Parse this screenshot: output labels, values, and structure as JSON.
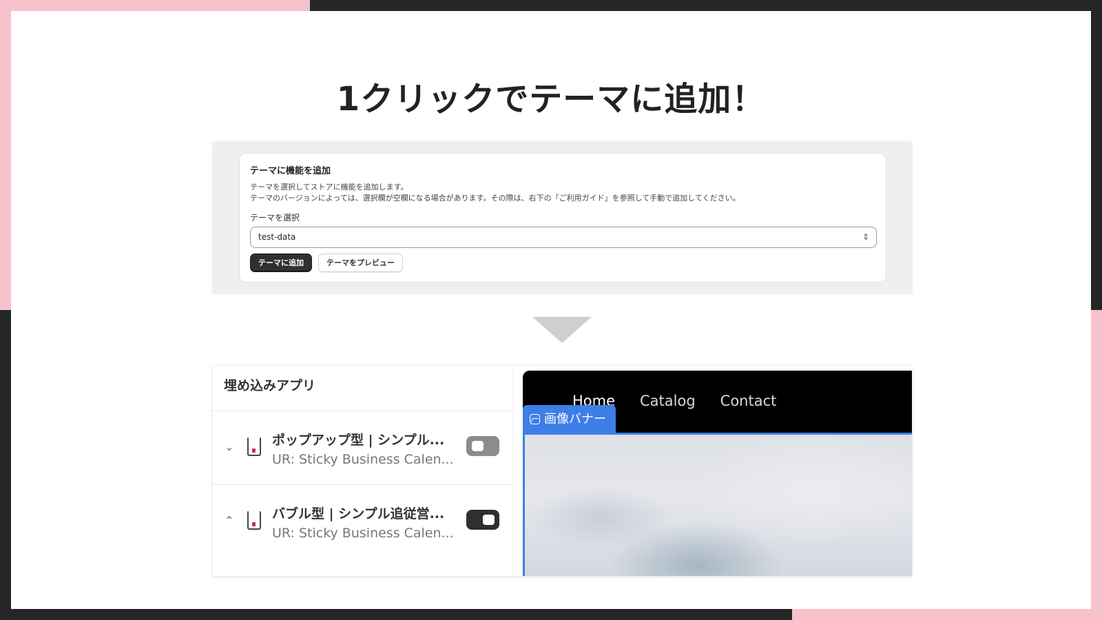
{
  "slide": {
    "title": "1クリックでテーマに追加！"
  },
  "colors": {
    "frame_dark": "#262626",
    "frame_pink": "#f6c3cd",
    "accent_blue": "#3d7fe6"
  },
  "add_feature_card": {
    "title": "テーマに機能を追加",
    "desc_line1": "テーマを選択してストアに機能を追加します。",
    "desc_line2": "テーマのバージョンによっては、選択欄が空欄になる場合があります。その際は、右下の「ご利用ガイド」を参照して手動で追加してください。",
    "select_label": "テーマを選択",
    "select_value": "test-data",
    "add_button": "テーマに追加",
    "preview_button": "テーマをプレビュー"
  },
  "embed_panel": {
    "header": "埋め込みアプリ",
    "items": [
      {
        "title": "ポップアップ型 | シンプル...",
        "subtitle": "UR: Sticky Business Calen...",
        "expanded": false,
        "enabled": false,
        "chevron": "⌄"
      },
      {
        "title": "バブル型 | シンプル追従営...",
        "subtitle": "UR: Sticky Business Calen...",
        "expanded": true,
        "enabled": true,
        "chevron": "⌃"
      }
    ]
  },
  "preview": {
    "nav": [
      "Home",
      "Catalog",
      "Contact"
    ],
    "active_nav": "Home",
    "banner_label": "画像バナー"
  },
  "icons": {
    "select": "chevron-up-down-icon",
    "item": "phone-icon",
    "banner": "image-icon",
    "arrow": "down-triangle-icon"
  }
}
